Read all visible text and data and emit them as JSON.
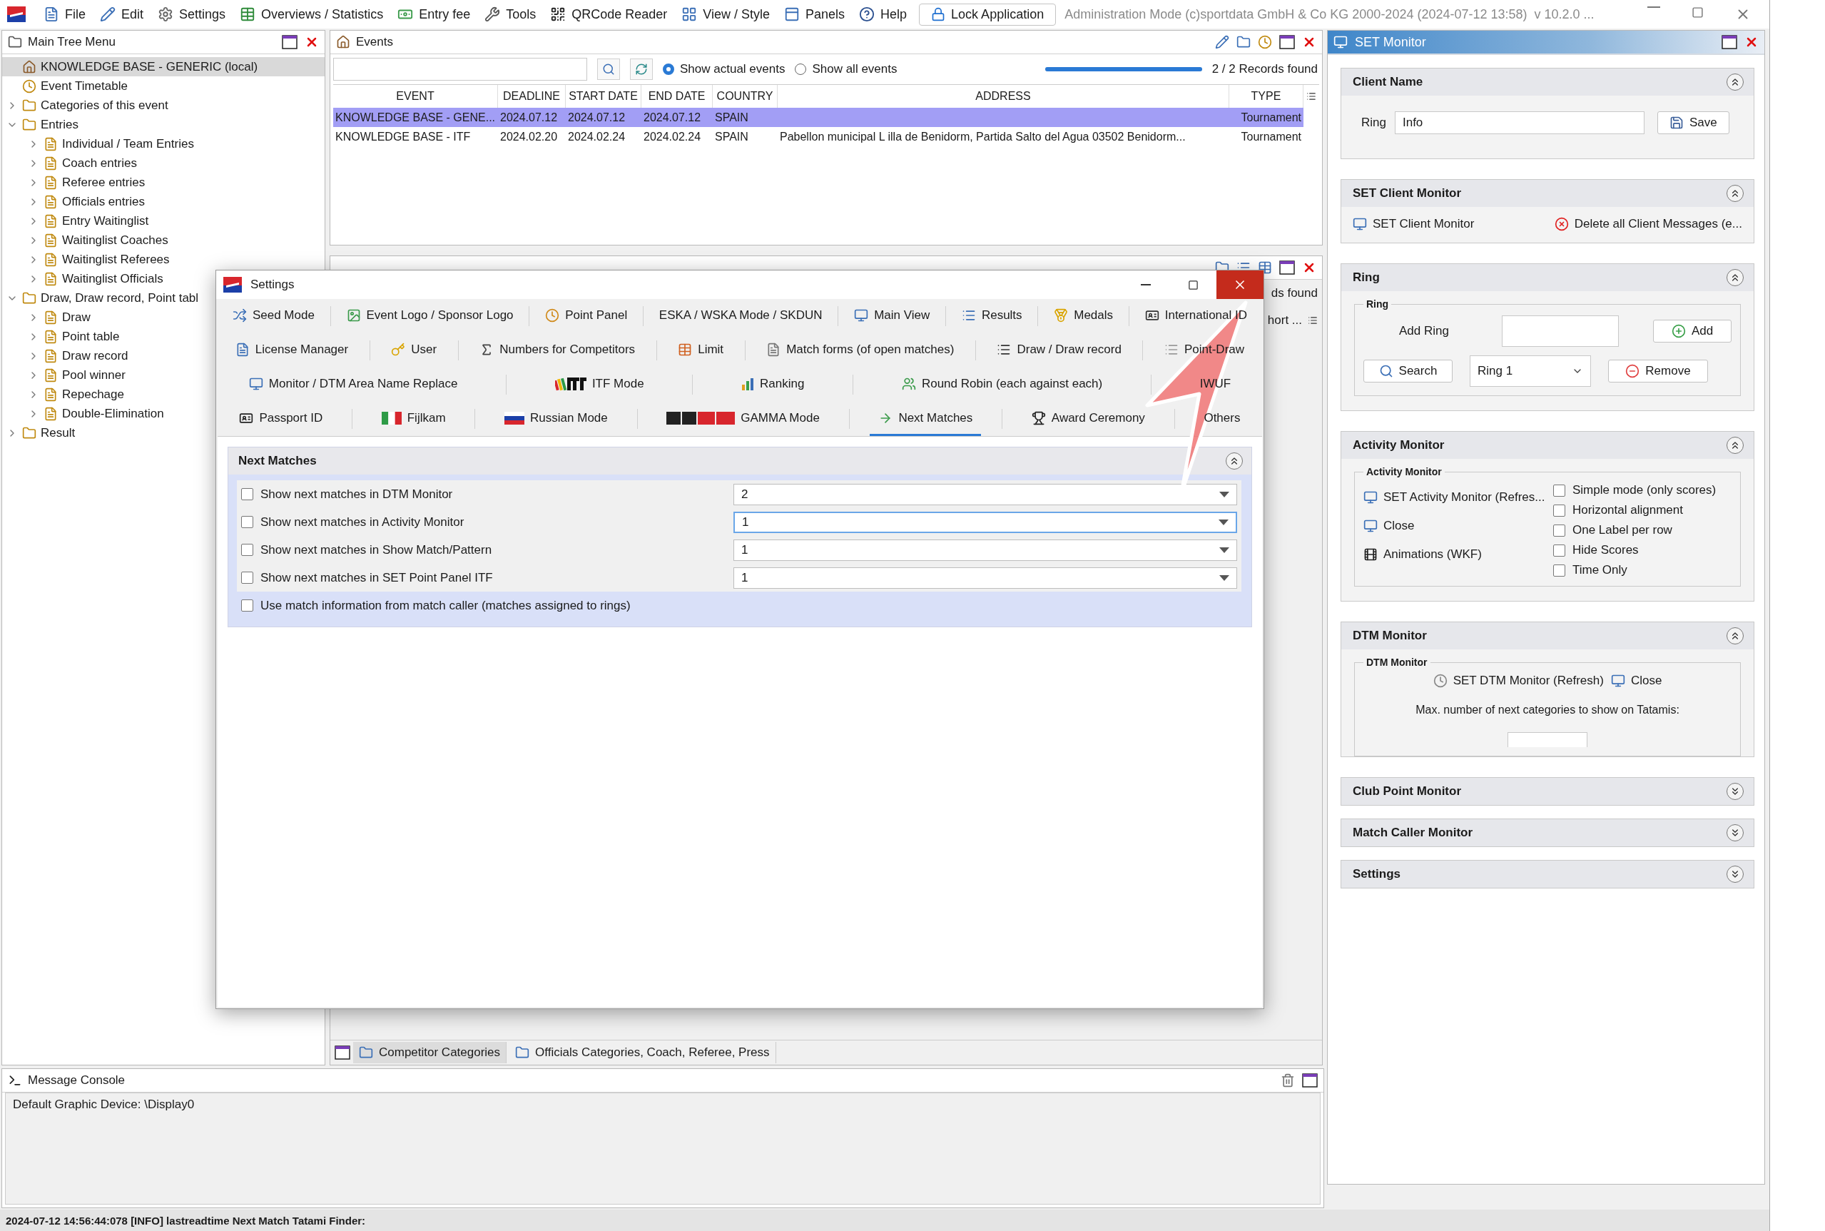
{
  "menu_bar": {
    "items": [
      {
        "label": "File"
      },
      {
        "label": "Edit"
      },
      {
        "label": "Settings"
      },
      {
        "label": "Overviews / Statistics"
      },
      {
        "label": "Entry fee"
      },
      {
        "label": "Tools"
      },
      {
        "label": "QRCode Reader"
      },
      {
        "label": "View / Style"
      },
      {
        "label": "Panels"
      },
      {
        "label": "Help"
      }
    ],
    "lock_button": "Lock Application",
    "title": "Administration Mode (c)sportdata GmbH & Co KG 2000-2024 (2024-07-12 13:58)  v 10.2.0 ..."
  },
  "main_tree": {
    "title": "Main Tree Menu",
    "items": [
      {
        "label": "KNOWLEDGE BASE - GENERIC (local)",
        "selected": true
      },
      {
        "label": "Event Timetable",
        "selected": false
      },
      {
        "label": "Categories of this event",
        "selected": false,
        "expanded": false
      },
      {
        "label": "Entries",
        "selected": false,
        "expanded": true,
        "children": [
          {
            "label": "Individual / Team Entries",
            "selected": false,
            "expanded": false
          },
          {
            "label": "Coach entries",
            "selected": false,
            "expanded": false
          },
          {
            "label": "Referee entries",
            "selected": false,
            "expanded": false
          },
          {
            "label": "Officials entries",
            "selected": false,
            "expanded": false
          },
          {
            "label": "Entry Waitinglist",
            "selected": false,
            "expanded": false
          },
          {
            "label": "Waitinglist Coaches",
            "selected": false,
            "expanded": false
          },
          {
            "label": "Waitinglist Referees",
            "selected": false,
            "expanded": false
          },
          {
            "label": "Waitinglist Officials",
            "selected": false,
            "expanded": false
          }
        ]
      },
      {
        "label": "Draw, Draw record, Point tabl",
        "selected": false,
        "expanded": true,
        "children": [
          {
            "label": "Draw",
            "selected": false,
            "expanded": false
          },
          {
            "label": "Point table",
            "selected": false,
            "expanded": false
          },
          {
            "label": "Draw record",
            "selected": false,
            "expanded": false
          },
          {
            "label": "Pool winner",
            "selected": false,
            "expanded": false
          },
          {
            "label": "Repechage",
            "selected": false,
            "expanded": false
          },
          {
            "label": "Double-Elimination",
            "selected": false,
            "expanded": false
          }
        ]
      },
      {
        "label": "Result",
        "selected": false,
        "expanded": false
      }
    ]
  },
  "events": {
    "title": "Events",
    "filters": [
      {
        "label": "Show actual events",
        "selected": true
      },
      {
        "label": "Show all events",
        "selected": false
      }
    ],
    "progress": {
      "level": 1
    },
    "records": "2 / 2 Records found",
    "columns": [
      "EVENT",
      "DEADLINE",
      "START DATE",
      "END DATE",
      "COUNTRY",
      "ADDRESS",
      "TYPE"
    ],
    "rows": [
      {
        "cells": [
          "KNOWLEDGE BASE - GENE...",
          "2024.07.12",
          "2024.07.12",
          "2024.07.12",
          "SPAIN",
          "",
          "Tournament"
        ],
        "selected": true
      },
      {
        "cells": [
          "KNOWLEDGE BASE - ITF",
          "2024.02.20",
          "2024.02.24",
          "2024.02.24",
          "SPAIN",
          "Pabellon municipal L illa de Benidorm, Partida Salto del Agua 03502 Benidorm...",
          "Tournament"
        ],
        "selected": false
      }
    ]
  },
  "competitor_panel": {
    "records": "ds found",
    "column_header": "hort ...",
    "tabs": [
      {
        "label": "Competitor Categories",
        "selected": true
      },
      {
        "label": "Officials Categories, Coach, Referee, Press",
        "selected": false
      }
    ]
  },
  "message_console": {
    "title": "Message Console",
    "lines": [
      "Default Graphic Device: \\Display0"
    ]
  },
  "status_bar": "2024-07-12 14:56:44:078 [INFO] lastreadtime Next Match Tatami Finder:",
  "set_monitor": {
    "title": "SET Monitor",
    "sections": [
      {
        "kind": "client",
        "title": "Client Name",
        "expanded": true,
        "label": "Ring",
        "value": "Info",
        "button": "Save"
      },
      {
        "kind": "client_monitor",
        "title": "SET Client Monitor",
        "expanded": true,
        "actions": [
          "SET Client Monitor",
          "Delete all Client Messages (e..."
        ]
      },
      {
        "kind": "ring",
        "title": "Ring",
        "expanded": true,
        "group": "Ring",
        "add_label": "Add Ring",
        "add_button": "Add",
        "search_button": "Search",
        "ring_select": "Ring 1",
        "remove_button": "Remove"
      },
      {
        "kind": "activity",
        "title": "Activity Monitor",
        "expanded": true,
        "group": "Activity Monitor",
        "actions": [
          "SET Activity Monitor (Refres...",
          "Close",
          "Animations (WKF)"
        ],
        "options": [
          {
            "label": "Simple mode (only scores)",
            "checked": false
          },
          {
            "label": "Horizontal alignment",
            "checked": false
          },
          {
            "label": "One Label per row",
            "checked": false
          },
          {
            "label": "Hide Scores",
            "checked": false
          },
          {
            "label": "Time Only",
            "checked": false
          }
        ]
      },
      {
        "kind": "dtm",
        "title": "DTM Monitor",
        "expanded": true,
        "group": "DTM Monitor",
        "actions": [
          "SET DTM Monitor (Refresh)",
          "Close"
        ],
        "note": "Max. number of next categories to show on Tatamis:"
      },
      {
        "title": "Club Point Monitor",
        "expanded": false
      },
      {
        "title": "Match Caller Monitor",
        "expanded": false
      },
      {
        "title": "Settings",
        "expanded": false
      }
    ]
  },
  "settings_dialog": {
    "title": "Settings",
    "tab_rows": [
      [
        {
          "label": "Seed Mode",
          "selected": false
        },
        {
          "label": "Event Logo / Sponsor Logo",
          "selected": false
        },
        {
          "label": "Point Panel",
          "selected": false
        },
        {
          "label": "ESKA / WSKA Mode / SKDUN",
          "selected": false
        },
        {
          "label": "Main View",
          "selected": false
        },
        {
          "label": "Results",
          "selected": false
        },
        {
          "label": "Medals",
          "selected": false
        },
        {
          "label": "International ID",
          "selected": false
        }
      ],
      [
        {
          "label": "License Manager",
          "selected": false
        },
        {
          "label": "User",
          "selected": false
        },
        {
          "label": "Numbers for Competitors",
          "selected": false
        },
        {
          "label": "Limit",
          "selected": false
        },
        {
          "label": "Match forms (of open matches)",
          "selected": false
        },
        {
          "label": "Draw / Draw record",
          "selected": false
        },
        {
          "label": "Point-Draw",
          "selected": false
        }
      ],
      [
        {
          "label": "Monitor / DTM Area Name Replace",
          "selected": false
        },
        {
          "label": "ITF Mode",
          "selected": false
        },
        {
          "label": "Ranking",
          "selected": false
        },
        {
          "label": "Round Robin (each against each)",
          "selected": false
        },
        {
          "label": "IWUF",
          "selected": false
        }
      ],
      [
        {
          "label": "Passport ID",
          "selected": false
        },
        {
          "label": "Fijlkam",
          "selected": false
        },
        {
          "label": "Russian Mode",
          "selected": false
        },
        {
          "label": "GAMMA Mode",
          "selected": false
        },
        {
          "label": "Next Matches",
          "selected": true
        },
        {
          "label": "Award Ceremony",
          "selected": false
        },
        {
          "label": "Others",
          "selected": false
        }
      ]
    ],
    "section": {
      "title": "Next Matches",
      "expanded": true,
      "options": [
        {
          "label": "Show next matches in DTM Monitor",
          "checked": false,
          "value": "2",
          "focused": false
        },
        {
          "label": "Show next matches in Activity Monitor",
          "checked": false,
          "value": "1",
          "focused": true
        },
        {
          "label": "Show next matches in Show Match/Pattern",
          "checked": false,
          "value": "1",
          "focused": false
        },
        {
          "label": "Show next matches in SET Point Panel ITF",
          "checked": false,
          "value": "1",
          "focused": false
        },
        {
          "label": "Use match information from match caller (matches assigned to rings)",
          "checked": false
        }
      ]
    }
  }
}
